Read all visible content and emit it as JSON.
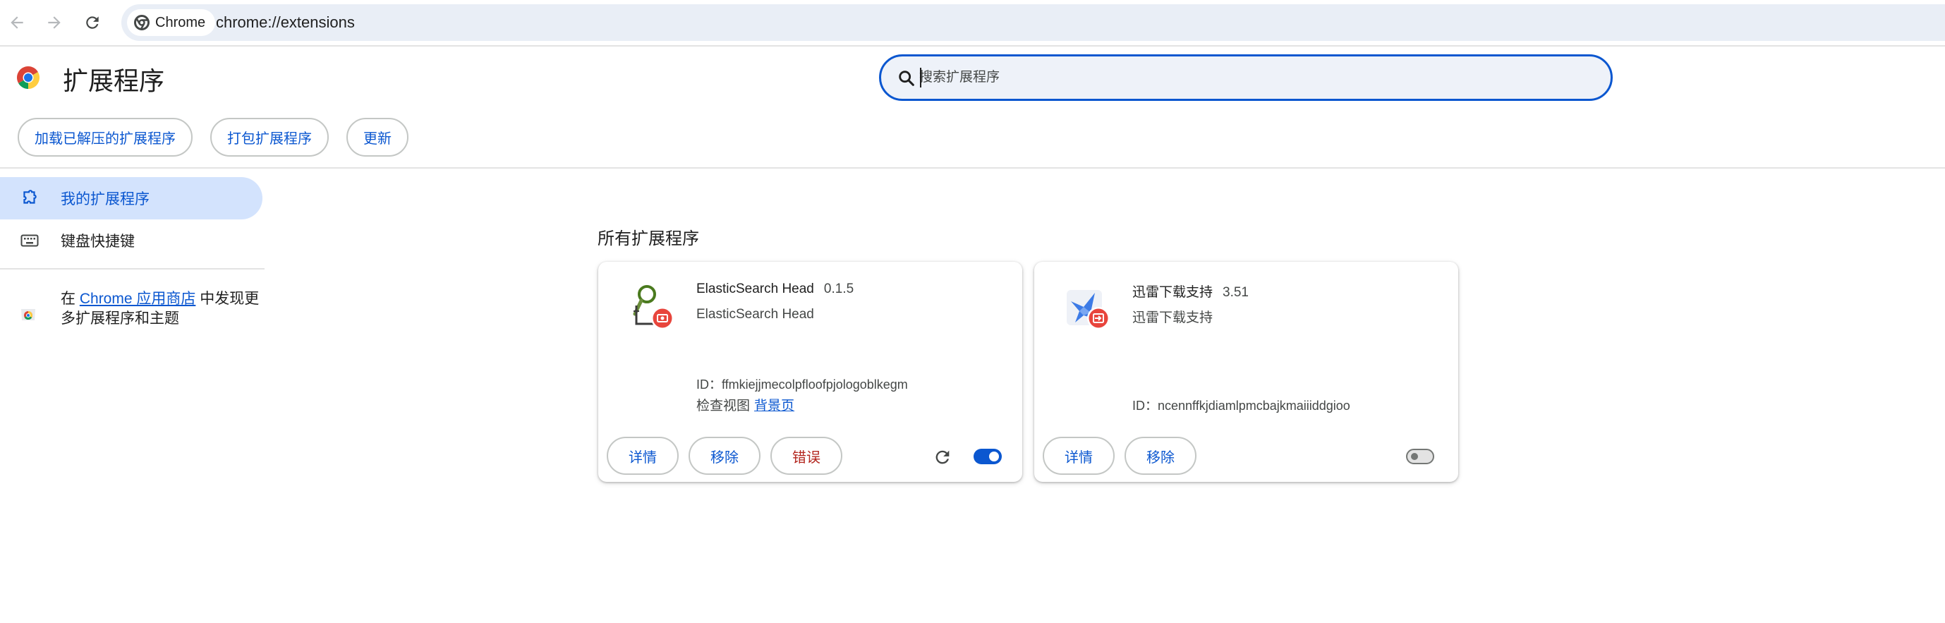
{
  "browser": {
    "site_chip": "Chrome",
    "url": "chrome://extensions"
  },
  "header": {
    "title": "扩展程序",
    "search_placeholder": "搜索扩展程序",
    "actions": {
      "load_unpacked": "加载已解压的扩展程序",
      "pack": "打包扩展程序",
      "update": "更新"
    }
  },
  "sidebar": {
    "items": [
      {
        "label": "我的扩展程序",
        "icon": "puzzle-piece-icon",
        "active": true
      },
      {
        "label": "键盘快捷键",
        "icon": "keyboard-icon",
        "active": false
      }
    ],
    "promo": {
      "prefix": "在 ",
      "link": "Chrome 应用商店",
      "suffix": " 中发现更多扩展程序和主题"
    }
  },
  "main": {
    "section_title": "所有扩展程序",
    "extensions": [
      {
        "name": "ElasticSearch Head",
        "version": "0.1.5",
        "description": "ElasticSearch Head",
        "id": "ID：ffmkiejjmecolpfloofpjologoblkegm",
        "views_label": "检查视图",
        "views_link": "背景页",
        "details_label": "详情",
        "remove_label": "移除",
        "errors_label": "错误",
        "enabled": true
      },
      {
        "name": "迅雷下载支持",
        "version": "3.51",
        "description": "迅雷下载支持",
        "id": "ID：ncennffkjdiamlpmcbajkmaiiiddgioo",
        "details_label": "详情",
        "remove_label": "移除",
        "enabled": false
      }
    ]
  },
  "colors": {
    "accent": "#0b57d0",
    "active_bg": "#d3e3fd",
    "error": "#b3261e",
    "badge": "#e8453c"
  }
}
